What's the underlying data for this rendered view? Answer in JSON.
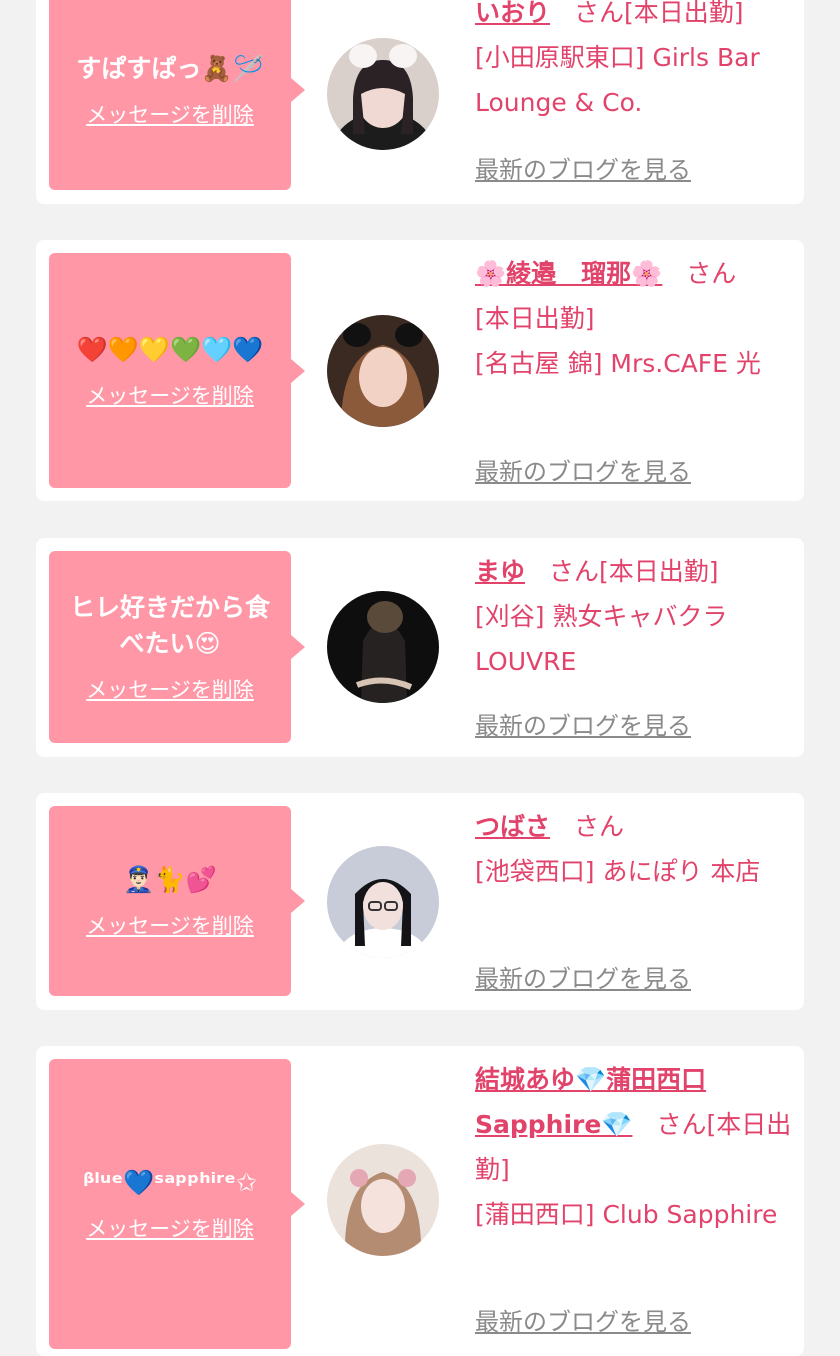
{
  "delete_label": "メッセージを削除",
  "blog_label": "最新のブログを見る",
  "entries": [
    {
      "message": "すぱすぱっ🧸🪡",
      "name": "いおり",
      "honorific": "さん",
      "status": "[本日出勤]",
      "shop": "[小田原駅東口] Girls Bar Lounge & Co."
    },
    {
      "message": "❤️🧡💛💚🩵💙",
      "name": "🌸綾邉　瑠那🌸",
      "honorific": "さん",
      "status": "[本日出勤]",
      "shop": "[名古屋 錦] Mrs.CAFE 光"
    },
    {
      "message": "ヒレ好きだから食べたい😍",
      "name": "まゆ",
      "honorific": "さん",
      "status": "[本日出勤]",
      "shop": "[刈谷] 熟女キャバクラ LOUVRE"
    },
    {
      "message": "👮🏻‍♂️🐈💕",
      "name": "つばさ",
      "honorific": "さん",
      "status": "",
      "shop": "[池袋西口] あにぽり 本店"
    },
    {
      "message": "ᵝˡᵘᵉ💙ˢᵃᵖᵖʰⁱʳᵉ✩",
      "name": "結城あゆ💎蒲田西口Sapphire💎",
      "honorific": "さん",
      "status": "[本日出勤]",
      "shop": "[蒲田西口] Club Sapphire"
    }
  ],
  "colors": {
    "background": "#f2f2f2",
    "bubble": "#ff97a7",
    "accent": "#e2436b",
    "link_gray": "#8a8a8a"
  }
}
